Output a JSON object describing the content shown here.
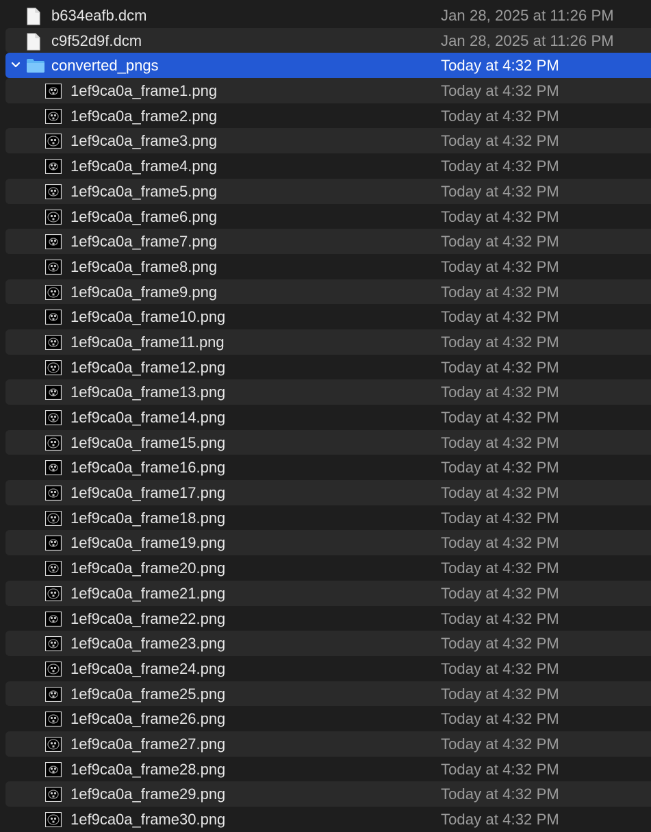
{
  "rows": [
    {
      "kind": "file",
      "depth": 0,
      "name": "b634eafb.dcm",
      "date": "Jan 28, 2025 at 11:26 PM"
    },
    {
      "kind": "file",
      "depth": 0,
      "name": "c9f52d9f.dcm",
      "date": "Jan 28, 2025 at 11:26 PM"
    },
    {
      "kind": "folder",
      "depth": 0,
      "expanded": true,
      "selected": true,
      "name": "converted_pngs",
      "date": "Today at 4:32 PM"
    },
    {
      "kind": "image",
      "depth": 1,
      "name": "1ef9ca0a_frame1.png",
      "date": "Today at 4:32 PM"
    },
    {
      "kind": "image",
      "depth": 1,
      "name": "1ef9ca0a_frame2.png",
      "date": "Today at 4:32 PM"
    },
    {
      "kind": "image",
      "depth": 1,
      "name": "1ef9ca0a_frame3.png",
      "date": "Today at 4:32 PM"
    },
    {
      "kind": "image",
      "depth": 1,
      "name": "1ef9ca0a_frame4.png",
      "date": "Today at 4:32 PM"
    },
    {
      "kind": "image",
      "depth": 1,
      "name": "1ef9ca0a_frame5.png",
      "date": "Today at 4:32 PM"
    },
    {
      "kind": "image",
      "depth": 1,
      "name": "1ef9ca0a_frame6.png",
      "date": "Today at 4:32 PM"
    },
    {
      "kind": "image",
      "depth": 1,
      "name": "1ef9ca0a_frame7.png",
      "date": "Today at 4:32 PM"
    },
    {
      "kind": "image",
      "depth": 1,
      "name": "1ef9ca0a_frame8.png",
      "date": "Today at 4:32 PM"
    },
    {
      "kind": "image",
      "depth": 1,
      "name": "1ef9ca0a_frame9.png",
      "date": "Today at 4:32 PM"
    },
    {
      "kind": "image",
      "depth": 1,
      "name": "1ef9ca0a_frame10.png",
      "date": "Today at 4:32 PM"
    },
    {
      "kind": "image",
      "depth": 1,
      "name": "1ef9ca0a_frame11.png",
      "date": "Today at 4:32 PM"
    },
    {
      "kind": "image",
      "depth": 1,
      "name": "1ef9ca0a_frame12.png",
      "date": "Today at 4:32 PM"
    },
    {
      "kind": "image",
      "depth": 1,
      "name": "1ef9ca0a_frame13.png",
      "date": "Today at 4:32 PM"
    },
    {
      "kind": "image",
      "depth": 1,
      "name": "1ef9ca0a_frame14.png",
      "date": "Today at 4:32 PM"
    },
    {
      "kind": "image",
      "depth": 1,
      "name": "1ef9ca0a_frame15.png",
      "date": "Today at 4:32 PM"
    },
    {
      "kind": "image",
      "depth": 1,
      "name": "1ef9ca0a_frame16.png",
      "date": "Today at 4:32 PM"
    },
    {
      "kind": "image",
      "depth": 1,
      "name": "1ef9ca0a_frame17.png",
      "date": "Today at 4:32 PM"
    },
    {
      "kind": "image",
      "depth": 1,
      "name": "1ef9ca0a_frame18.png",
      "date": "Today at 4:32 PM"
    },
    {
      "kind": "image",
      "depth": 1,
      "name": "1ef9ca0a_frame19.png",
      "date": "Today at 4:32 PM"
    },
    {
      "kind": "image",
      "depth": 1,
      "name": "1ef9ca0a_frame20.png",
      "date": "Today at 4:32 PM"
    },
    {
      "kind": "image",
      "depth": 1,
      "name": "1ef9ca0a_frame21.png",
      "date": "Today at 4:32 PM"
    },
    {
      "kind": "image",
      "depth": 1,
      "name": "1ef9ca0a_frame22.png",
      "date": "Today at 4:32 PM"
    },
    {
      "kind": "image",
      "depth": 1,
      "name": "1ef9ca0a_frame23.png",
      "date": "Today at 4:32 PM"
    },
    {
      "kind": "image",
      "depth": 1,
      "name": "1ef9ca0a_frame24.png",
      "date": "Today at 4:32 PM"
    },
    {
      "kind": "image",
      "depth": 1,
      "name": "1ef9ca0a_frame25.png",
      "date": "Today at 4:32 PM"
    },
    {
      "kind": "image",
      "depth": 1,
      "name": "1ef9ca0a_frame26.png",
      "date": "Today at 4:32 PM"
    },
    {
      "kind": "image",
      "depth": 1,
      "name": "1ef9ca0a_frame27.png",
      "date": "Today at 4:32 PM"
    },
    {
      "kind": "image",
      "depth": 1,
      "name": "1ef9ca0a_frame28.png",
      "date": "Today at 4:32 PM"
    },
    {
      "kind": "image",
      "depth": 1,
      "name": "1ef9ca0a_frame29.png",
      "date": "Today at 4:32 PM"
    },
    {
      "kind": "image",
      "depth": 1,
      "name": "1ef9ca0a_frame30.png",
      "date": "Today at 4:32 PM"
    }
  ],
  "colors": {
    "background": "#1e1e1e",
    "stripe": "#2a2a2a",
    "selection": "#2359d4",
    "folder": "#5cb4f5"
  },
  "icons": {
    "file": "document-icon",
    "folder": "folder-icon",
    "image": "image-thumbnail-icon",
    "disclosure": "chevron-down-icon"
  }
}
